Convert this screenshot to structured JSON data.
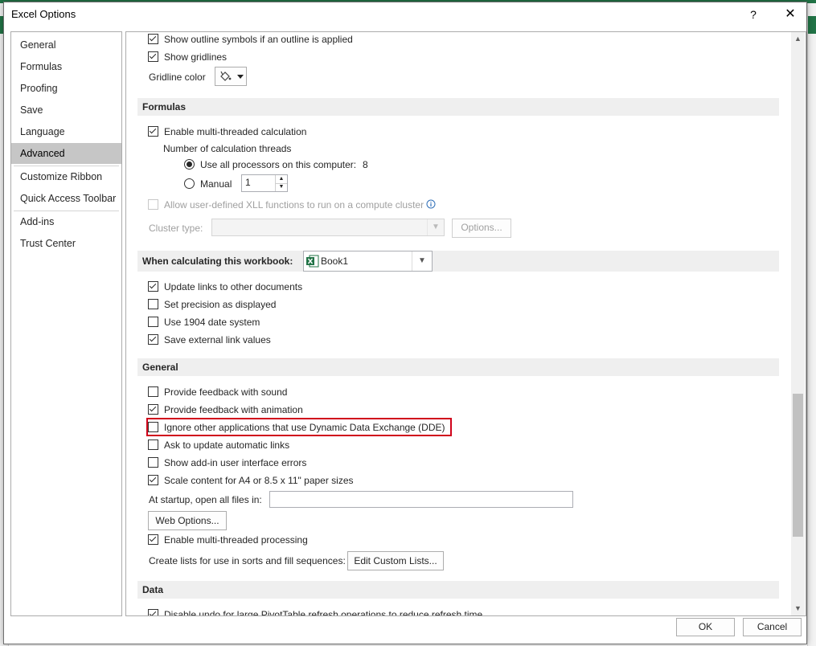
{
  "window": {
    "title": "Excel Options",
    "help_label": "?",
    "close_label": "✕"
  },
  "sidebar": {
    "items": [
      {
        "label": "General",
        "active": false
      },
      {
        "label": "Formulas",
        "active": false
      },
      {
        "label": "Proofing",
        "active": false
      },
      {
        "label": "Save",
        "active": false
      },
      {
        "label": "Language",
        "active": false
      },
      {
        "label": "Advanced",
        "active": true
      },
      {
        "label": "Customize Ribbon",
        "active": false
      },
      {
        "label": "Quick Access Toolbar",
        "active": false
      },
      {
        "label": "Add-ins",
        "active": false
      },
      {
        "label": "Trust Center",
        "active": false
      }
    ]
  },
  "display": {
    "outline_symbols": "Show outline symbols if an outline is applied",
    "gridlines": "Show gridlines",
    "gridline_color_label": "Gridline color"
  },
  "formulas": {
    "header": "Formulas",
    "multithreaded": "Enable multi-threaded calculation",
    "threads_label": "Number of calculation threads",
    "use_all_label": "Use all processors on this computer:",
    "processor_count": "8",
    "manual_label": "Manual",
    "manual_value": "1",
    "xll_label": "Allow user-defined XLL functions to run on a compute cluster",
    "cluster_type_label": "Cluster type:",
    "options_button": "Options..."
  },
  "workbook": {
    "header": "When calculating this workbook:",
    "book_name": "Book1",
    "update_links": "Update links to other documents",
    "set_precision": "Set precision as displayed",
    "date_1904": "Use 1904 date system",
    "save_external": "Save external link values"
  },
  "general": {
    "header": "General",
    "feedback_sound": "Provide feedback with sound",
    "feedback_animation": "Provide feedback with animation",
    "ignore_dde": "Ignore other applications that use Dynamic Data Exchange (DDE)",
    "ask_update": "Ask to update automatic links",
    "show_addin_errors": "Show add-in user interface errors",
    "scale_content": "Scale content for A4 or 8.5 x 11\" paper sizes",
    "startup_label": "At startup, open all files in:",
    "startup_value": "",
    "web_options_button": "Web Options...",
    "multithreaded_processing": "Enable multi-threaded processing",
    "create_lists_label": "Create lists for use in sorts and fill sequences:",
    "edit_lists_button": "Edit Custom Lists..."
  },
  "data": {
    "header": "Data",
    "disable_undo": "Disable undo for large PivotTable refresh operations to reduce refresh time"
  },
  "footer": {
    "ok_label": "OK",
    "cancel_label": "Cancel"
  },
  "colors": {
    "accent_green": "#217346",
    "highlight_red": "#d0021b",
    "active_nav": "#c6c6c6"
  },
  "icons": {
    "gridline_color": "paint-bucket-icon",
    "info": "info-icon",
    "excel_file": "excel-file-icon"
  }
}
